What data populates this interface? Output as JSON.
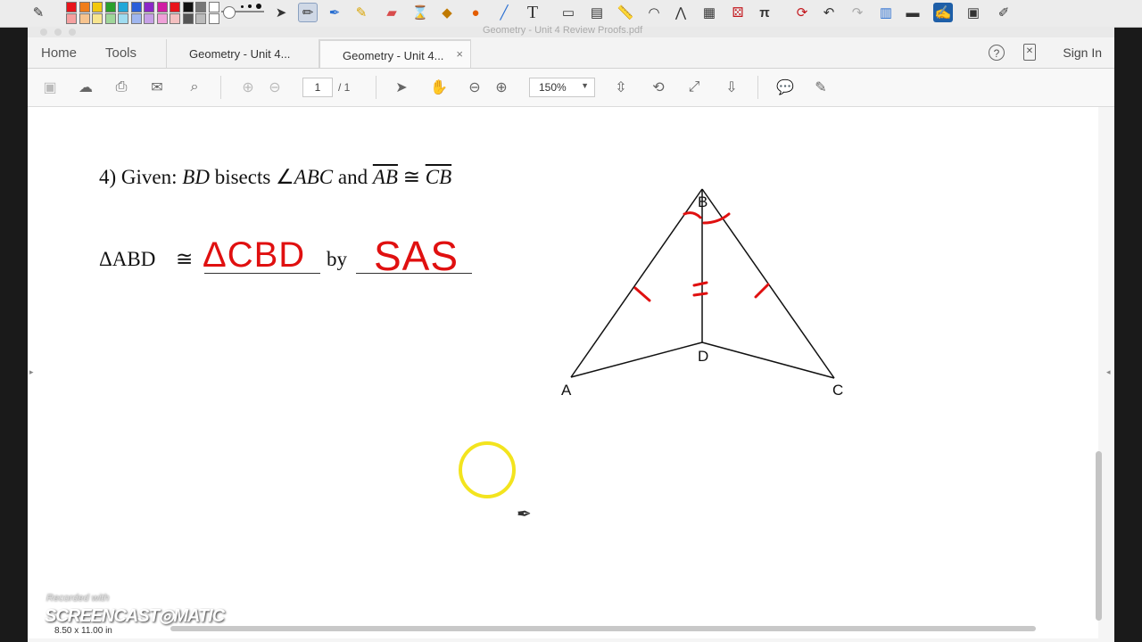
{
  "window_title": "Geometry - Unit 4 Review Proofs.pdf",
  "colors": {
    "annotation_red": "#e01010",
    "cursor_highlight": "#f3e41e",
    "palette": [
      "#e8141b",
      "#f07d1a",
      "#f2c80e",
      "#2aa02c",
      "#21a7d8",
      "#2b5fd9",
      "#8b27c7",
      "#d01ea3",
      "#e8141b",
      "#111111",
      "#777777",
      "#ffffff",
      "#f5a0a0",
      "#f7c48f",
      "#f8e58e",
      "#9fd69a",
      "#9fdcf0",
      "#9fb6ef",
      "#c6a0e6",
      "#efa0d8",
      "#f4c0c0",
      "#555555",
      "#bbbbbb",
      "#ffffff"
    ]
  },
  "annotation_toolbar": {
    "tools": [
      "annotate-app-icon",
      "select-arrow-icon",
      "pen-icon",
      "highlighter-icon",
      "marker-icon",
      "eraser-icon",
      "hourglass-icon",
      "paint-bucket-icon",
      "shape-icon",
      "line-icon",
      "text-tool-icon",
      "screen-capture-icon",
      "scroll-icon",
      "ruler-icon",
      "protractor-icon",
      "compass-icon",
      "calculator-icon",
      "dice-icon",
      "pi-icon",
      "refresh-icon",
      "undo-icon",
      "redo-icon",
      "pages-icon",
      "whiteboard-icon",
      "desktop-draw-icon",
      "notes-icon",
      "settings-icon"
    ]
  },
  "nav": {
    "home": "Home",
    "tools": "Tools",
    "tabs": [
      {
        "label": "Geometry - Unit 4..."
      },
      {
        "label": "Geometry - Unit 4..."
      }
    ],
    "close_symbol": "×",
    "sign_in": "Sign In",
    "help_symbol": "?"
  },
  "toolbar": {
    "page_current": "1",
    "page_total": "/ 1",
    "zoom": "150%"
  },
  "document": {
    "problem_number": "4) Given:",
    "segment_bd": "BD",
    "bisects": "bisects",
    "angle": "∠",
    "angle_abc": "ABC",
    "and": "and",
    "seg_ab": "AB",
    "congruent": "≅",
    "seg_cb": "CB",
    "triangle_abd": "ΔABD",
    "by": "by",
    "answer_triangle": "ΔCBD",
    "answer_reason": "SAS",
    "vertex_labels": {
      "a": "A",
      "b": "B",
      "c": "C",
      "d": "D"
    }
  },
  "status": {
    "page_size": "8.50 x 11.00 in"
  },
  "watermark": {
    "recorded_with": "Recorded with",
    "brand": "SCREENCAST◎MATIC"
  }
}
